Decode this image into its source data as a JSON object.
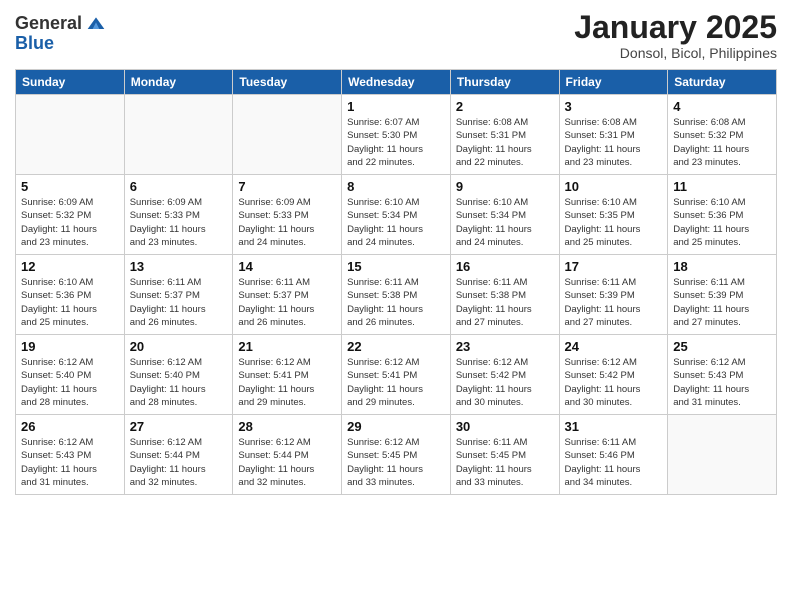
{
  "header": {
    "logo_line1": "General",
    "logo_line2": "Blue",
    "month_title": "January 2025",
    "subtitle": "Donsol, Bicol, Philippines"
  },
  "days_of_week": [
    "Sunday",
    "Monday",
    "Tuesday",
    "Wednesday",
    "Thursday",
    "Friday",
    "Saturday"
  ],
  "weeks": [
    [
      {
        "day": "",
        "info": ""
      },
      {
        "day": "",
        "info": ""
      },
      {
        "day": "",
        "info": ""
      },
      {
        "day": "1",
        "info": "Sunrise: 6:07 AM\nSunset: 5:30 PM\nDaylight: 11 hours\nand 22 minutes."
      },
      {
        "day": "2",
        "info": "Sunrise: 6:08 AM\nSunset: 5:31 PM\nDaylight: 11 hours\nand 22 minutes."
      },
      {
        "day": "3",
        "info": "Sunrise: 6:08 AM\nSunset: 5:31 PM\nDaylight: 11 hours\nand 23 minutes."
      },
      {
        "day": "4",
        "info": "Sunrise: 6:08 AM\nSunset: 5:32 PM\nDaylight: 11 hours\nand 23 minutes."
      }
    ],
    [
      {
        "day": "5",
        "info": "Sunrise: 6:09 AM\nSunset: 5:32 PM\nDaylight: 11 hours\nand 23 minutes."
      },
      {
        "day": "6",
        "info": "Sunrise: 6:09 AM\nSunset: 5:33 PM\nDaylight: 11 hours\nand 23 minutes."
      },
      {
        "day": "7",
        "info": "Sunrise: 6:09 AM\nSunset: 5:33 PM\nDaylight: 11 hours\nand 24 minutes."
      },
      {
        "day": "8",
        "info": "Sunrise: 6:10 AM\nSunset: 5:34 PM\nDaylight: 11 hours\nand 24 minutes."
      },
      {
        "day": "9",
        "info": "Sunrise: 6:10 AM\nSunset: 5:34 PM\nDaylight: 11 hours\nand 24 minutes."
      },
      {
        "day": "10",
        "info": "Sunrise: 6:10 AM\nSunset: 5:35 PM\nDaylight: 11 hours\nand 25 minutes."
      },
      {
        "day": "11",
        "info": "Sunrise: 6:10 AM\nSunset: 5:36 PM\nDaylight: 11 hours\nand 25 minutes."
      }
    ],
    [
      {
        "day": "12",
        "info": "Sunrise: 6:10 AM\nSunset: 5:36 PM\nDaylight: 11 hours\nand 25 minutes."
      },
      {
        "day": "13",
        "info": "Sunrise: 6:11 AM\nSunset: 5:37 PM\nDaylight: 11 hours\nand 26 minutes."
      },
      {
        "day": "14",
        "info": "Sunrise: 6:11 AM\nSunset: 5:37 PM\nDaylight: 11 hours\nand 26 minutes."
      },
      {
        "day": "15",
        "info": "Sunrise: 6:11 AM\nSunset: 5:38 PM\nDaylight: 11 hours\nand 26 minutes."
      },
      {
        "day": "16",
        "info": "Sunrise: 6:11 AM\nSunset: 5:38 PM\nDaylight: 11 hours\nand 27 minutes."
      },
      {
        "day": "17",
        "info": "Sunrise: 6:11 AM\nSunset: 5:39 PM\nDaylight: 11 hours\nand 27 minutes."
      },
      {
        "day": "18",
        "info": "Sunrise: 6:11 AM\nSunset: 5:39 PM\nDaylight: 11 hours\nand 27 minutes."
      }
    ],
    [
      {
        "day": "19",
        "info": "Sunrise: 6:12 AM\nSunset: 5:40 PM\nDaylight: 11 hours\nand 28 minutes."
      },
      {
        "day": "20",
        "info": "Sunrise: 6:12 AM\nSunset: 5:40 PM\nDaylight: 11 hours\nand 28 minutes."
      },
      {
        "day": "21",
        "info": "Sunrise: 6:12 AM\nSunset: 5:41 PM\nDaylight: 11 hours\nand 29 minutes."
      },
      {
        "day": "22",
        "info": "Sunrise: 6:12 AM\nSunset: 5:41 PM\nDaylight: 11 hours\nand 29 minutes."
      },
      {
        "day": "23",
        "info": "Sunrise: 6:12 AM\nSunset: 5:42 PM\nDaylight: 11 hours\nand 30 minutes."
      },
      {
        "day": "24",
        "info": "Sunrise: 6:12 AM\nSunset: 5:42 PM\nDaylight: 11 hours\nand 30 minutes."
      },
      {
        "day": "25",
        "info": "Sunrise: 6:12 AM\nSunset: 5:43 PM\nDaylight: 11 hours\nand 31 minutes."
      }
    ],
    [
      {
        "day": "26",
        "info": "Sunrise: 6:12 AM\nSunset: 5:43 PM\nDaylight: 11 hours\nand 31 minutes."
      },
      {
        "day": "27",
        "info": "Sunrise: 6:12 AM\nSunset: 5:44 PM\nDaylight: 11 hours\nand 32 minutes."
      },
      {
        "day": "28",
        "info": "Sunrise: 6:12 AM\nSunset: 5:44 PM\nDaylight: 11 hours\nand 32 minutes."
      },
      {
        "day": "29",
        "info": "Sunrise: 6:12 AM\nSunset: 5:45 PM\nDaylight: 11 hours\nand 33 minutes."
      },
      {
        "day": "30",
        "info": "Sunrise: 6:11 AM\nSunset: 5:45 PM\nDaylight: 11 hours\nand 33 minutes."
      },
      {
        "day": "31",
        "info": "Sunrise: 6:11 AM\nSunset: 5:46 PM\nDaylight: 11 hours\nand 34 minutes."
      },
      {
        "day": "",
        "info": ""
      }
    ]
  ]
}
